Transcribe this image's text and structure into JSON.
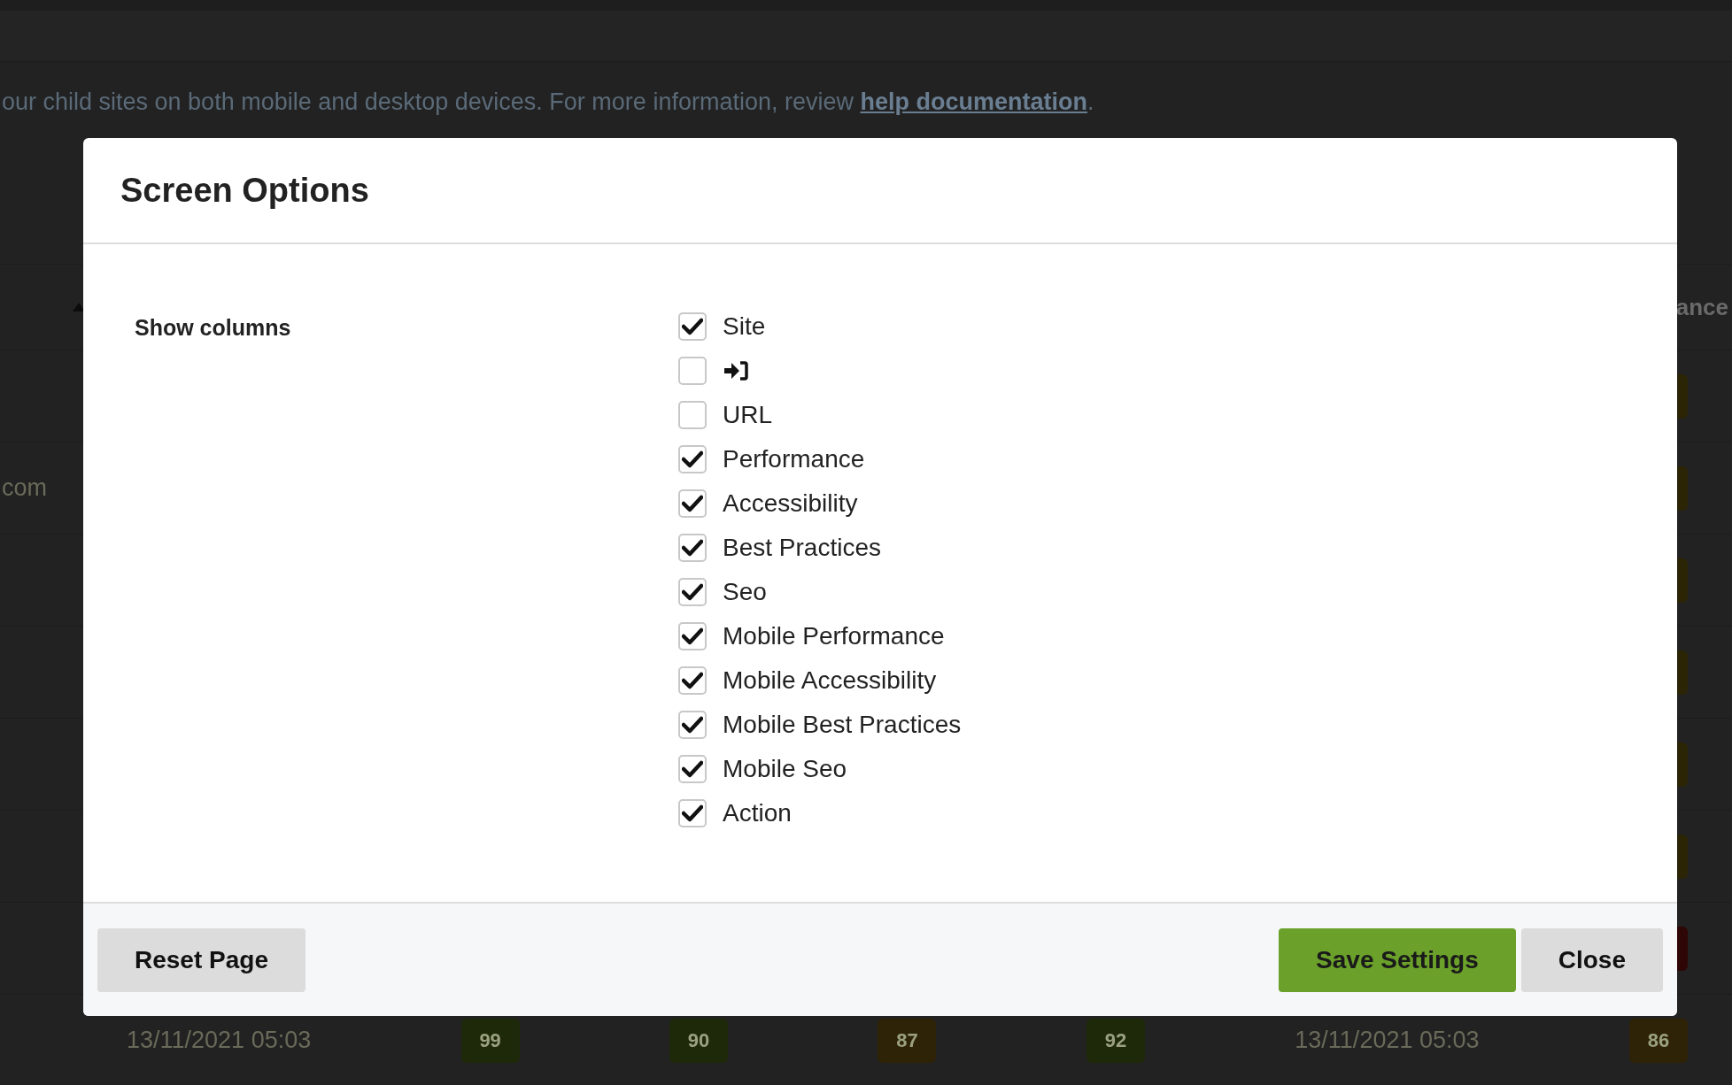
{
  "background": {
    "intro": {
      "text": "our child sites on both mobile and desktop devices. For more information, review ",
      "link": "help documentation",
      "tail": "."
    },
    "table": {
      "header_tail": "ance",
      "rows": [
        {
          "color": "#2b2506"
        },
        {
          "site": "com",
          "color": "#2b2506"
        },
        {
          "color": "#2b2506"
        },
        {
          "color": "#2b2506"
        },
        {
          "color": "#2b2506"
        },
        {
          "color": "#2b2506"
        },
        {
          "color": "#2e0606"
        },
        {
          "date": "13/11/2021 05:03",
          "scores": [
            {
              "value": "99",
              "color": "#1d2908"
            },
            {
              "value": "90",
              "color": "#1d2908"
            },
            {
              "value": "87",
              "color": "#2e2306"
            },
            {
              "value": "92",
              "color": "#1d2908"
            }
          ],
          "date2": "13/11/2021 05:03",
          "last": "86",
          "color": "#2e2306"
        }
      ]
    }
  },
  "dialog": {
    "title": "Screen Options",
    "section_label": "Show columns",
    "options": [
      {
        "kind": "text",
        "label": "Site",
        "checked": true
      },
      {
        "kind": "icon",
        "checked": false
      },
      {
        "kind": "text",
        "label": "URL",
        "checked": false
      },
      {
        "kind": "text",
        "label": "Performance",
        "checked": true
      },
      {
        "kind": "text",
        "label": "Accessibility",
        "checked": true
      },
      {
        "kind": "text",
        "label": "Best Practices",
        "checked": true
      },
      {
        "kind": "text",
        "label": "Seo",
        "checked": true
      },
      {
        "kind": "text",
        "label": "Mobile Performance",
        "checked": true
      },
      {
        "kind": "text",
        "label": "Mobile Accessibility",
        "checked": true
      },
      {
        "kind": "text",
        "label": "Mobile Best Practices",
        "checked": true
      },
      {
        "kind": "text",
        "label": "Mobile Seo",
        "checked": true
      },
      {
        "kind": "text",
        "label": "Action",
        "checked": true
      }
    ],
    "buttons": [
      {
        "kind": "secondary",
        "label": "Reset Page"
      },
      {
        "kind": "primary",
        "label": "Save Settings"
      },
      {
        "kind": "secondary",
        "label": "Close"
      }
    ]
  }
}
